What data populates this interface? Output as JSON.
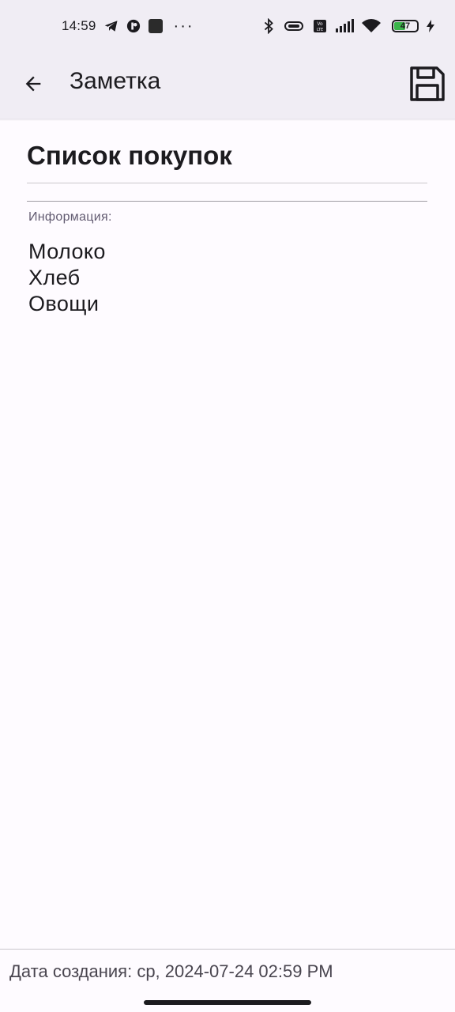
{
  "status_bar": {
    "time": "14:59",
    "battery_percent": "47",
    "icons": [
      "telegram-icon",
      "app-badge-icon",
      "square-app-icon",
      "more-dots-icon",
      "bluetooth-icon",
      "vibrate-icon",
      "volte-icon",
      "signal-icon",
      "wifi-icon",
      "battery-icon",
      "charging-icon"
    ]
  },
  "app_bar": {
    "title": "Заметка",
    "back_icon": "arrow-back-icon",
    "save_icon": "floppy-disk-icon"
  },
  "note": {
    "title": "Список покупок",
    "info_label": "Информация:",
    "info_lines": [
      "Молоко",
      "Хлеб",
      "Овощи"
    ]
  },
  "footer": {
    "created_text": "Дата создания: ср, 2024-07-24 02:59 PM"
  },
  "colors": {
    "app_bar_bg": "#f0edf4",
    "page_bg": "#fefbff",
    "label_color": "#625b71",
    "battery_fill": "#3ab54a"
  }
}
